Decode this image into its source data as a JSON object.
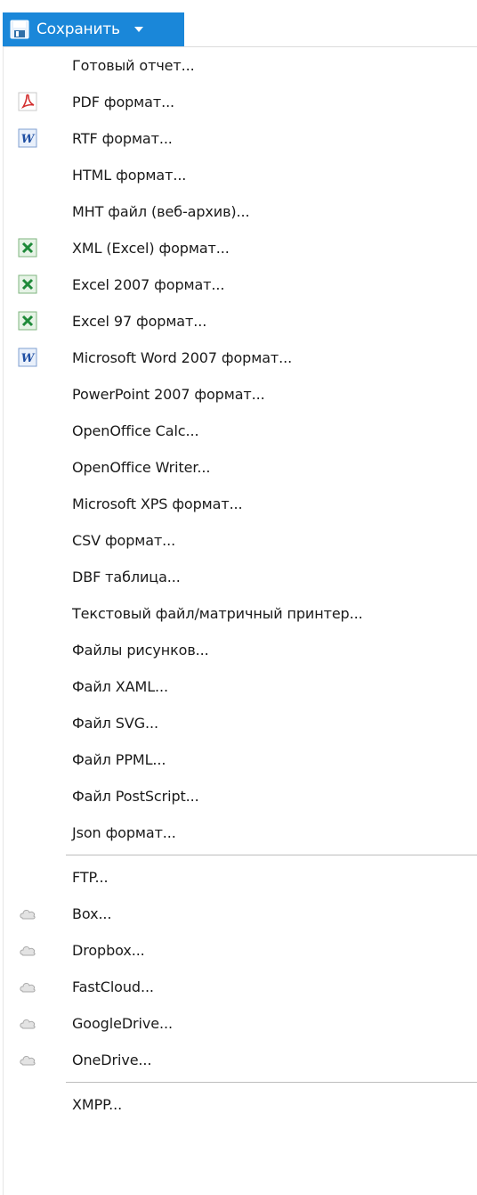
{
  "save_button": {
    "label": "Сохранить",
    "icon": "floppy-disk-icon",
    "dropdown_icon": "chevron-down-icon",
    "color": "#1a87d9"
  },
  "menu": {
    "group1": [
      {
        "label": "Готовый отчет...",
        "icon": ""
      },
      {
        "label": "PDF формат...",
        "icon": "pdf-icon"
      },
      {
        "label": "RTF формат...",
        "icon": "word-icon"
      },
      {
        "label": "HTML формат...",
        "icon": ""
      },
      {
        "label": "MHT файл (веб-архив)...",
        "icon": ""
      },
      {
        "label": "XML (Excel) формат...",
        "icon": "excel-icon"
      },
      {
        "label": "Excel 2007 формат...",
        "icon": "excel-icon"
      },
      {
        "label": "Excel 97 формат...",
        "icon": "excel-icon"
      },
      {
        "label": "Microsoft Word 2007 формат...",
        "icon": "word-icon"
      },
      {
        "label": "PowerPoint 2007 формат...",
        "icon": ""
      },
      {
        "label": "OpenOffice Calc...",
        "icon": ""
      },
      {
        "label": "OpenOffice Writer...",
        "icon": ""
      },
      {
        "label": "Microsoft XPS формат...",
        "icon": ""
      },
      {
        "label": "CSV формат...",
        "icon": ""
      },
      {
        "label": "DBF таблица...",
        "icon": ""
      },
      {
        "label": "Текстовый файл/матричный принтер...",
        "icon": ""
      },
      {
        "label": "Файлы рисунков...",
        "icon": ""
      },
      {
        "label": "Файл XAML...",
        "icon": ""
      },
      {
        "label": "Файл SVG...",
        "icon": ""
      },
      {
        "label": "Файл PPML...",
        "icon": ""
      },
      {
        "label": "Файл PostScript...",
        "icon": ""
      },
      {
        "label": "Json формат...",
        "icon": ""
      }
    ],
    "group2": [
      {
        "label": "FTP...",
        "icon": ""
      },
      {
        "label": "Box...",
        "icon": "cloud-icon"
      },
      {
        "label": "Dropbox...",
        "icon": "cloud-icon"
      },
      {
        "label": "FastCloud...",
        "icon": "cloud-icon"
      },
      {
        "label": "GoogleDrive...",
        "icon": "cloud-icon"
      },
      {
        "label": "OneDrive...",
        "icon": "cloud-icon"
      }
    ],
    "group3": [
      {
        "label": "XMPP...",
        "icon": ""
      }
    ]
  }
}
